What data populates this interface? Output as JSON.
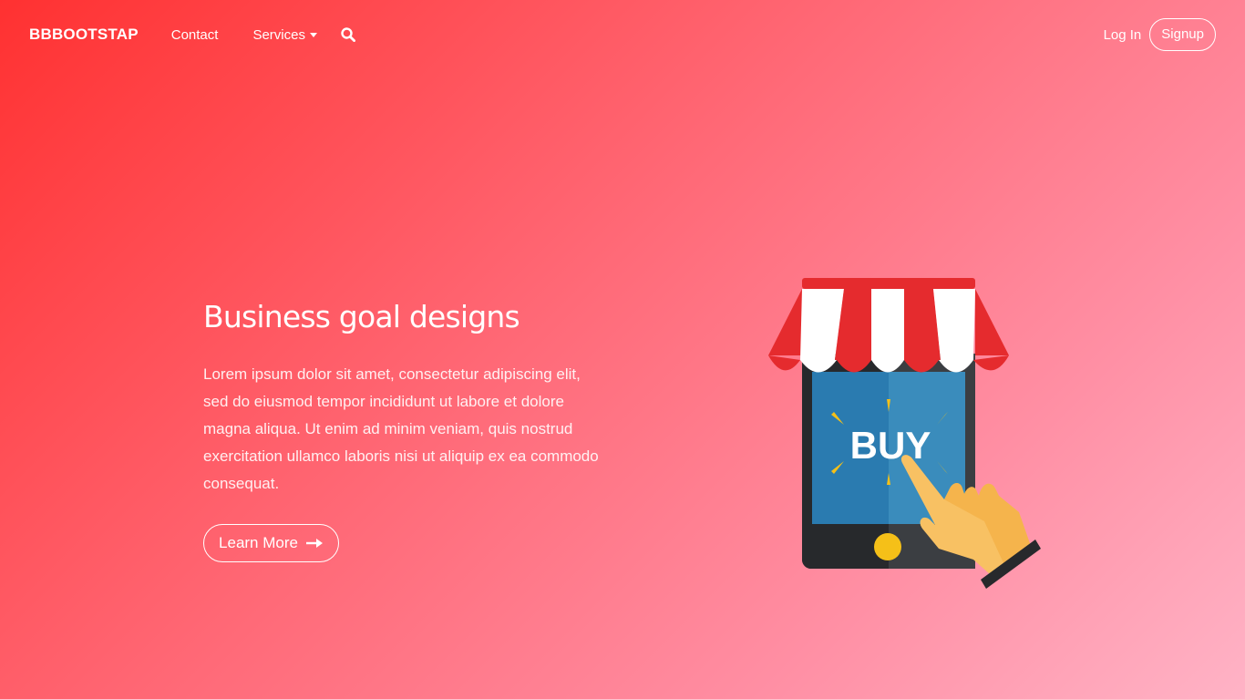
{
  "nav": {
    "brand": "BBBOOTSTAP",
    "links": [
      {
        "label": "Contact"
      },
      {
        "label": "Services"
      }
    ],
    "login": "Log In",
    "signup": "Signup"
  },
  "hero": {
    "title": "Business goal designs",
    "body": "Lorem ipsum dolor sit amet, consectetur adipiscing elit, sed do eiusmod tempor incididunt ut labore et dolore magna aliqua. Ut enim ad minim veniam, quis nostrud exercitation ullamco laboris nisi ut aliquip ex ea commodo consequat.",
    "cta": "Learn More"
  },
  "illustration": {
    "screen_text": "BUY"
  },
  "colors": {
    "gradient_start": "#ff3131",
    "gradient_end": "#ffb3c6",
    "awning_red": "#e52b2e",
    "screen_blue": "#2a7bb0",
    "phone_body": "#27292c",
    "button_yellow": "#f5c018",
    "hand": "#f8c163"
  },
  "icons": {
    "search": "search-icon",
    "caret": "caret-down-icon",
    "arrow": "arrow-right-icon"
  }
}
